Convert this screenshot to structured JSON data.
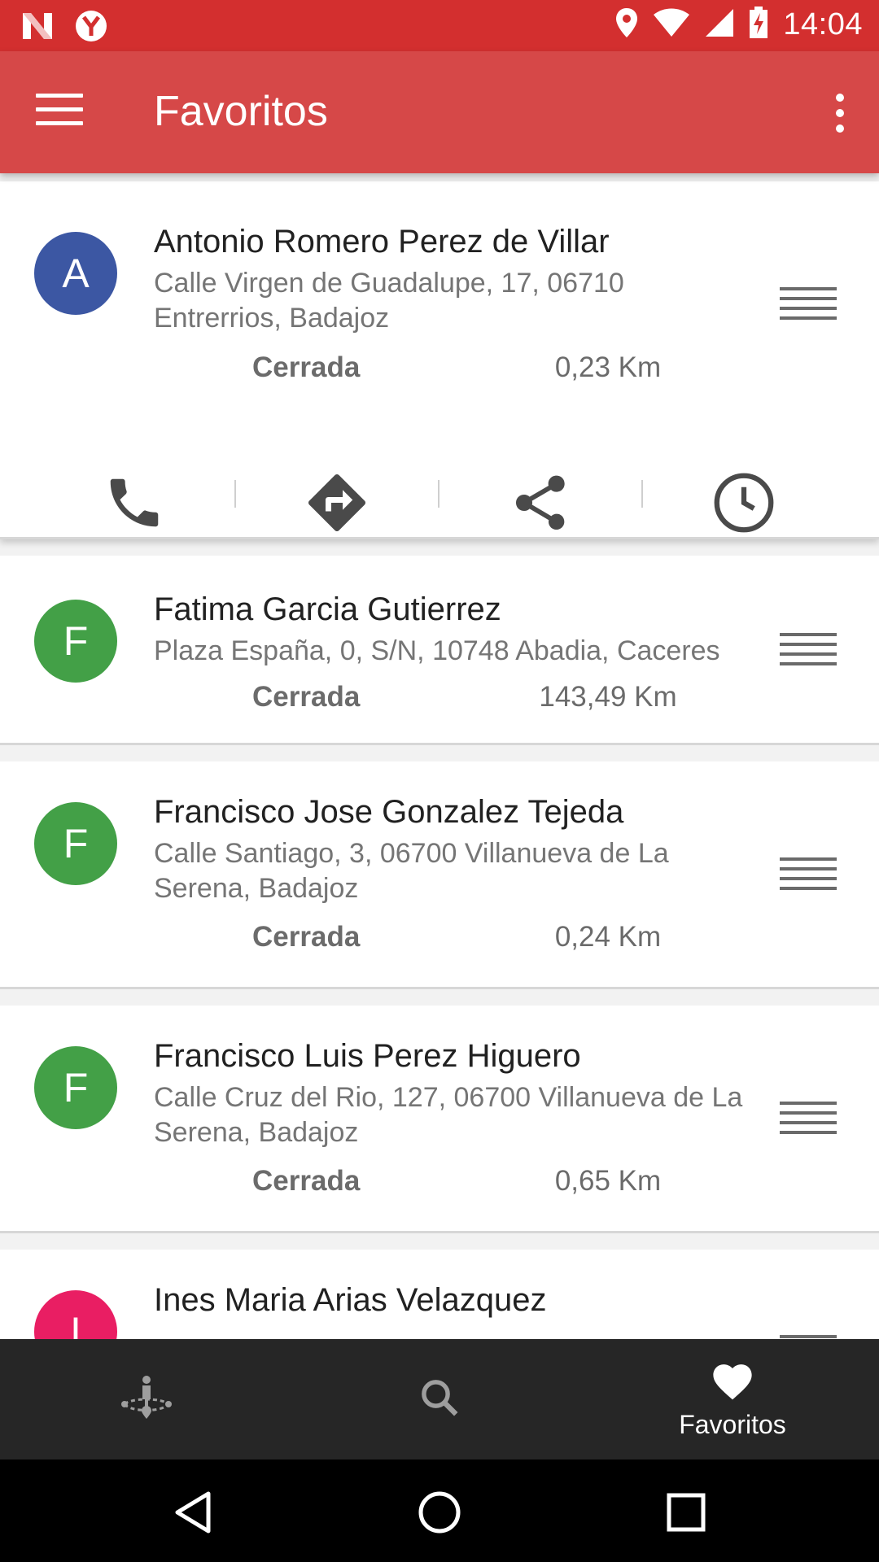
{
  "status_bar": {
    "time": "14:04",
    "icons": [
      "n-notification-icon",
      "y-app-icon",
      "location-icon",
      "wifi-icon",
      "signal-icon",
      "battery-charging-icon"
    ]
  },
  "app_bar": {
    "title": "Favoritos",
    "menu_icon": "hamburger-menu-icon",
    "overflow_icon": "more-vert-icon",
    "color": "#d64848"
  },
  "favorites": [
    {
      "initial": "A",
      "avatar_color": "#3c57a3",
      "name": "Antonio Romero Perez de Villar",
      "address": "Calle Virgen de Guadalupe, 17, 06710 Entrerrios, Badajoz",
      "status": "Cerrada",
      "distance": "0,23 Km",
      "expanded": true
    },
    {
      "initial": "F",
      "avatar_color": "#43a047",
      "name": "Fatima Garcia Gutierrez",
      "address": "Plaza España, 0, S/N, 10748 Abadia, Caceres",
      "status": "Cerrada",
      "distance": "143,49 Km"
    },
    {
      "initial": "F",
      "avatar_color": "#43a047",
      "name": "Francisco Jose Gonzalez Tejeda",
      "address": "Calle Santiago, 3, 06700 Villanueva de La Serena, Badajoz",
      "status": "Cerrada",
      "distance": "0,24 Km"
    },
    {
      "initial": "F",
      "avatar_color": "#43a047",
      "name": "Francisco Luis Perez Higuero",
      "address": "Calle Cruz del Rio, 127, 06700 Villanueva de La Serena, Badajoz",
      "status": "Cerrada",
      "distance": "0,65 Km"
    },
    {
      "initial": "I",
      "avatar_color": "#e91e63",
      "name": "Ines Maria Arias Velazquez"
    }
  ],
  "card_actions": [
    "phone-icon",
    "directions-icon",
    "share-icon",
    "clock-icon"
  ],
  "bottom_nav": {
    "items": [
      {
        "icon": "nearby-people-icon"
      },
      {
        "icon": "search-icon"
      },
      {
        "icon": "heart-icon",
        "label": "Favoritos",
        "active": true
      }
    ]
  },
  "system_nav": [
    "back-icon",
    "home-icon",
    "recents-icon"
  ]
}
